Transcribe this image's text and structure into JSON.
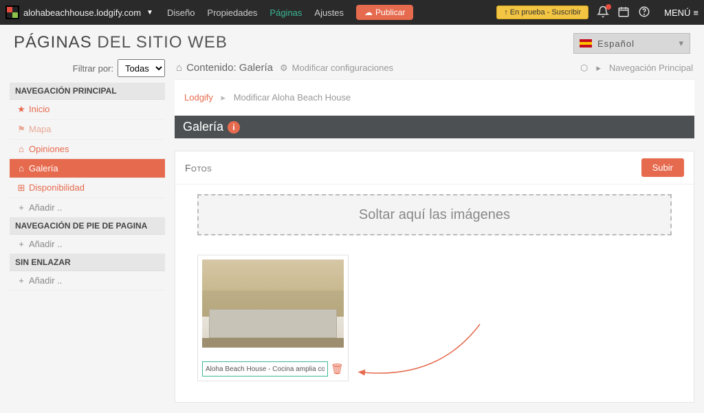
{
  "topbar": {
    "site": "alohabeachhouse.lodgify.com",
    "nav": {
      "design": "Diseño",
      "properties": "Propiedades",
      "pages": "Páginas",
      "settings": "Ajustes"
    },
    "publish": "Publicar",
    "trial": "En prueba - Suscribir",
    "menu": "MENÚ"
  },
  "pageTitle": {
    "strong": "PÁGINAS",
    "rest": " DEL SITIO WEB"
  },
  "language": "Español",
  "filter": {
    "label": "Filtrar por:",
    "value": "Todas"
  },
  "sidebar": {
    "hdr1": "NAVEGACIÓN PRINCIPAL",
    "items1": [
      {
        "icon": "★",
        "label": "Inicio",
        "cls": "red"
      },
      {
        "icon": "⚑",
        "label": "Mapa",
        "cls": "faded"
      },
      {
        "icon": "⌂",
        "label": "Opiniones",
        "cls": "red"
      },
      {
        "icon": "⌂",
        "label": "Galería",
        "cls": "active"
      },
      {
        "icon": "⊞",
        "label": "Disponibilidad",
        "cls": "red"
      },
      {
        "icon": "+",
        "label": "Añadir ..",
        "cls": "addrow"
      }
    ],
    "hdr2": "NAVEGACIÓN DE PIE DE PAGINA",
    "add2": "Añadir ..",
    "hdr3": "SIN ENLAZAR",
    "add3": "Añadir .."
  },
  "contentHead": {
    "title": "Contenido: Galería",
    "modify": "Modificar configuraciones",
    "navPrincipal": "Navegación Principal"
  },
  "crumbs": {
    "a": "Lodgify",
    "b": "Modificar Aloha Beach House"
  },
  "section": "Galería",
  "panel": {
    "title": "Fotos",
    "upload": "Subir",
    "drop": "Soltar aquí las imágenes",
    "caption": "Aloha Beach House - Cocina amplia con mu"
  }
}
